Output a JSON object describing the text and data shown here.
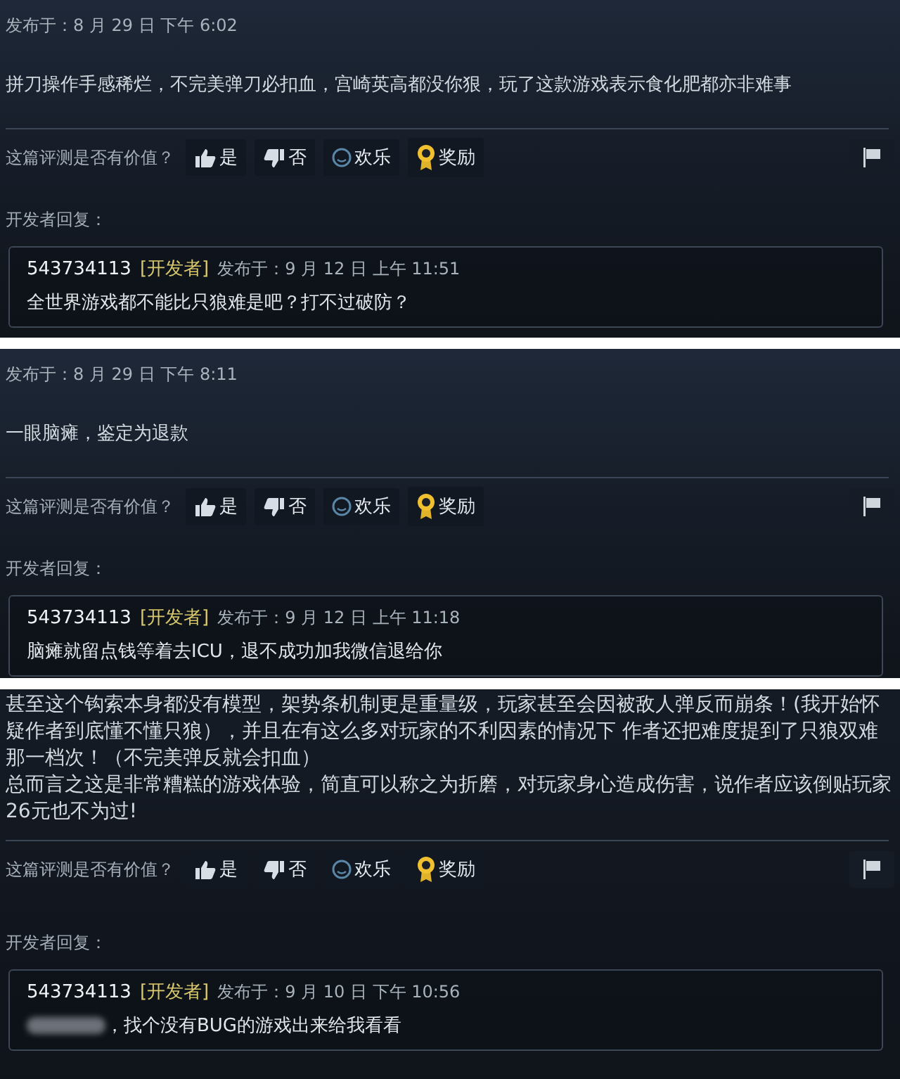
{
  "reviews": [
    {
      "posted": "发布于：8 月 29 日 下午 6:02",
      "text": [
        "拼刀操作手感稀烂，不完美弹刀必扣血，宫崎英高都没你狠，玩了这款游戏表示食化肥都亦非难事"
      ],
      "helpful_prompt": "这篇评测是否有价值？",
      "buttons": [
        {
          "kind": "up",
          "label": "是"
        },
        {
          "kind": "down",
          "label": "否"
        },
        {
          "kind": "funny",
          "label": "欢乐"
        },
        {
          "kind": "award",
          "label": "奖励"
        }
      ],
      "dev_label": "开发者回复：",
      "reply": {
        "author": "543734113",
        "tag": "[开发者]",
        "posted": "发布于：9 月 12 日 上午 11:51",
        "text": "全世界游戏都不能比只狼难是吧？打不过破防？",
        "blurred": false
      }
    },
    {
      "posted": "发布于：8 月 29 日 下午 8:11",
      "text": [
        "一眼脑瘫，鉴定为退款"
      ],
      "helpful_prompt": "这篇评测是否有价值？",
      "buttons": [
        {
          "kind": "up",
          "label": "是"
        },
        {
          "kind": "down",
          "label": "否"
        },
        {
          "kind": "funny",
          "label": "欢乐"
        },
        {
          "kind": "award",
          "label": "奖励"
        }
      ],
      "dev_label": "开发者回复：",
      "reply": {
        "author": "543734113",
        "tag": "[开发者]",
        "posted": "发布于：9 月 12 日 上午 11:18",
        "text": "脑瘫就留点钱等着去ICU，退不成功加我微信退给你",
        "blurred": false
      }
    },
    {
      "text": [
        "甚至这个钩索本身都没有模型，架势条机制更是重量级，玩家甚至会因被敌人弹反而崩条！(我开始怀疑作者到底懂不懂只狼），并且在有这么多对玩家的不利因素的情况下 作者还把难度提到了只狼双难那一档次！（不完美弹反就会扣血）",
        "总而言之这是非常糟糕的游戏体验，简直可以称之为折磨，对玩家身心造成伤害，说作者应该倒贴玩家26元也不为过!"
      ],
      "helpful_prompt": "这篇评测是否有价值？",
      "buttons": [
        {
          "kind": "up",
          "label": "是"
        },
        {
          "kind": "down",
          "label": "否"
        },
        {
          "kind": "funny",
          "label": "欢乐"
        },
        {
          "kind": "award",
          "label": "奖励"
        }
      ],
      "dev_label": "开发者回复：",
      "reply": {
        "author": "543734113",
        "tag": "[开发者]",
        "posted": "发布于：9 月 10 日 下午 10:56",
        "text": "，找个没有BUG的游戏出来给我看看",
        "blurred": true
      }
    }
  ]
}
